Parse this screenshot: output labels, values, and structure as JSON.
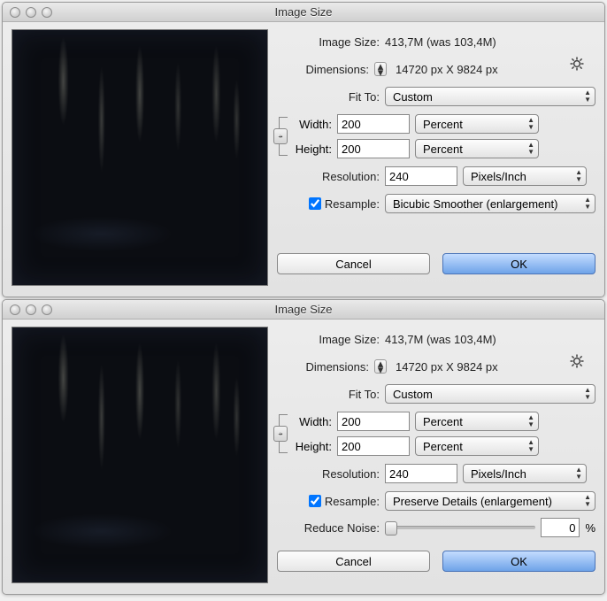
{
  "windows": [
    {
      "title": "Image Size",
      "imageSizeLabel": "Image Size:",
      "imageSizeValue": "413,7M (was 103,4M)",
      "dimensionsLabel": "Dimensions:",
      "dimensionsValue": "14720 px  X  9824 px",
      "fitToLabel": "Fit To:",
      "fitToValue": "Custom",
      "widthLabel": "Width:",
      "widthValue": "200",
      "widthUnit": "Percent",
      "heightLabel": "Height:",
      "heightValue": "200",
      "heightUnit": "Percent",
      "resolutionLabel": "Resolution:",
      "resolutionValue": "240",
      "resolutionUnit": "Pixels/Inch",
      "resampleLabel": "Resample:",
      "resampleChecked": true,
      "resampleValue": "Bicubic Smoother (enlargement)",
      "hasNoise": false,
      "cancel": "Cancel",
      "ok": "OK"
    },
    {
      "title": "Image Size",
      "imageSizeLabel": "Image Size:",
      "imageSizeValue": "413,7M (was 103,4M)",
      "dimensionsLabel": "Dimensions:",
      "dimensionsValue": "14720 px  X  9824 px",
      "fitToLabel": "Fit To:",
      "fitToValue": "Custom",
      "widthLabel": "Width:",
      "widthValue": "200",
      "widthUnit": "Percent",
      "heightLabel": "Height:",
      "heightValue": "200",
      "heightUnit": "Percent",
      "resolutionLabel": "Resolution:",
      "resolutionValue": "240",
      "resolutionUnit": "Pixels/Inch",
      "resampleLabel": "Resample:",
      "resampleChecked": true,
      "resampleValue": "Preserve Details (enlargement)",
      "hasNoise": true,
      "noiseLabel": "Reduce Noise:",
      "noiseValue": "0",
      "noisePct": "%",
      "cancel": "Cancel",
      "ok": "OK"
    }
  ]
}
